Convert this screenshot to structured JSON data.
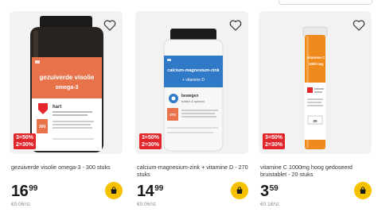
{
  "products": [
    {
      "name": "gezuiverde visolie omega-3 - 300 stuks",
      "price_int": "16",
      "price_dec": "99",
      "unit_price": "€0.06/st.",
      "badge": [
        "3=50%",
        "2=30%"
      ],
      "label_title": "gezuiverde visolie",
      "label_sub": "omega-3",
      "label_section": "hart",
      "label_count": "300",
      "accent": "#e8734a"
    },
    {
      "name": "calcium-magnesium-zink + vitamine D - 270 stuks",
      "price_int": "14",
      "price_dec": "99",
      "unit_price": "€0.06/st.",
      "badge": [
        "3=50%",
        "2=30%"
      ],
      "label_title": "calcium-magnesium-zink",
      "label_sub": "+ vitamine D",
      "label_section": "bewegen",
      "label_section2": "botten & spieren",
      "label_count": "270",
      "accent": "#2f79c6"
    },
    {
      "name": "vitamine C 1000mg hoog gedoseerd bruistablet - 20 stuks",
      "price_int": "3",
      "price_dec": "59",
      "unit_price": "€0.18/st.",
      "badge": [
        "3=50%",
        "2=30%"
      ],
      "label_title": "vitamine C",
      "label_sub": "1000 mg",
      "label_count": "20",
      "accent": "#f08a1c"
    }
  ],
  "colors": {
    "badge": "#e3262b",
    "cart": "#f6c200",
    "card_bg": "#f2f2f2"
  },
  "icons": {
    "favorite": "heart-icon",
    "cart": "shopping-bag-icon"
  }
}
